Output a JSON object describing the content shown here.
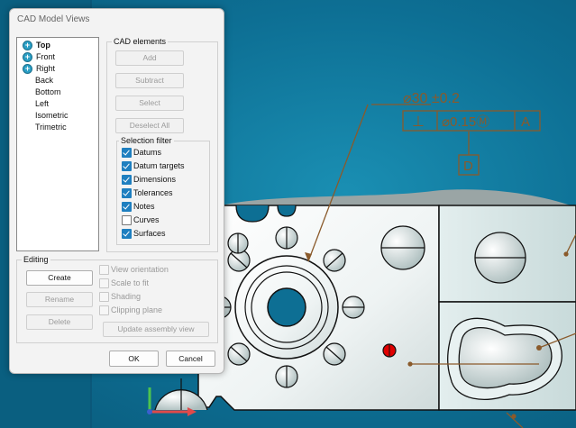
{
  "dialog": {
    "title": "CAD Model Views",
    "views": [
      {
        "label": "Top",
        "expandable": true,
        "selected": true
      },
      {
        "label": "Front",
        "expandable": true
      },
      {
        "label": "Right",
        "expandable": true
      },
      {
        "label": "Back"
      },
      {
        "label": "Bottom"
      },
      {
        "label": "Left"
      },
      {
        "label": "Isometric"
      },
      {
        "label": "Trimetric"
      }
    ],
    "cad_elements": {
      "label": "CAD elements",
      "add": "Add",
      "subtract": "Subtract",
      "select": "Select",
      "deselect_all": "Deselect All"
    },
    "selection_filter": {
      "label": "Selection filter",
      "items": [
        {
          "label": "Datums",
          "checked": true
        },
        {
          "label": "Datum targets",
          "checked": true
        },
        {
          "label": "Dimensions",
          "checked": true
        },
        {
          "label": "Tolerances",
          "checked": true
        },
        {
          "label": "Notes",
          "checked": true
        },
        {
          "label": "Curves",
          "checked": false
        },
        {
          "label": "Surfaces",
          "checked": true
        }
      ]
    },
    "editing": {
      "label": "Editing",
      "create": "Create",
      "rename": "Rename",
      "delete": "Delete",
      "view_orientation": "View orientation",
      "scale_to_fit": "Scale to fit",
      "shading": "Shading",
      "clipping_plane": "Clipping plane",
      "update_assembly_view": "Update assembly view"
    },
    "ok": "OK",
    "cancel": "Cancel"
  },
  "annotations": {
    "dimension": "⌀30 ±0.2",
    "fcf_symbol": "⊥",
    "fcf_tolerance": "⌀0.15Ⓜ",
    "fcf_datum": "A",
    "datum_label": "D"
  },
  "colors": {
    "background": "#0d6f94",
    "annotation": "#8a5a2b",
    "marker": "#e00000",
    "accent": "#1e7fc0"
  }
}
